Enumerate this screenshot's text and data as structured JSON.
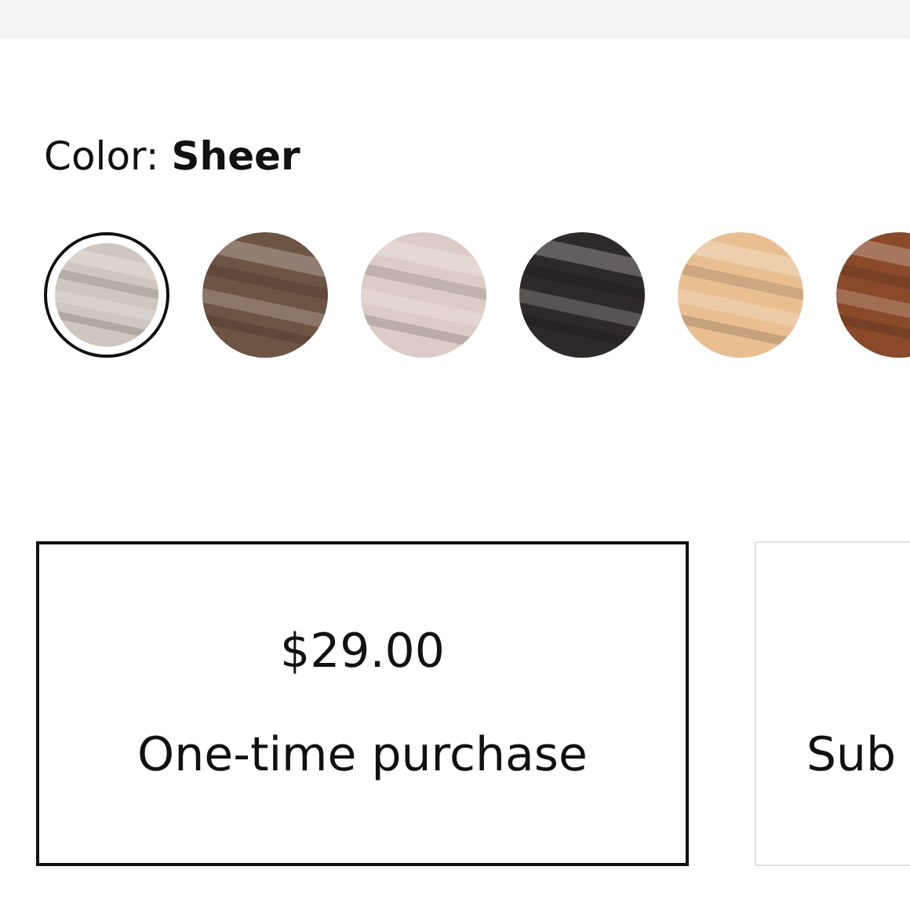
{
  "color_picker": {
    "label": "Color:",
    "value": "Sheer",
    "swatches": [
      {
        "color": "#cfc6bf",
        "selected": true
      },
      {
        "color": "#6e5443",
        "selected": false
      },
      {
        "color": "#dccbc6",
        "selected": false
      },
      {
        "color": "#2e2a29",
        "selected": false
      },
      {
        "color": "#e9bf92",
        "selected": false
      },
      {
        "color": "#8a4a2a",
        "selected": false
      }
    ]
  },
  "purchase_options": [
    {
      "price": "$29.00",
      "label": "One-time purchase",
      "selected": true
    },
    {
      "label": "Sub",
      "selected": false
    }
  ]
}
